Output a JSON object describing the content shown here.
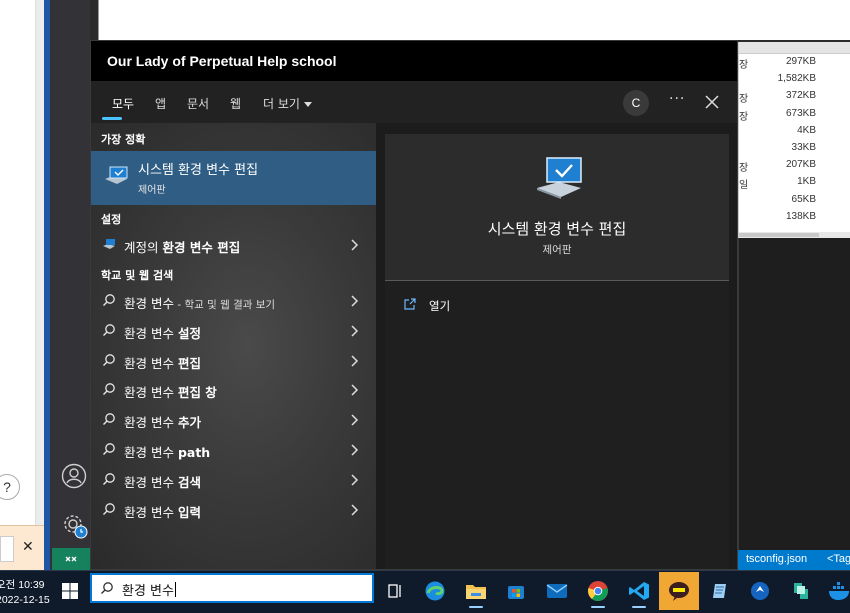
{
  "window": {
    "title": "Our Lady of Perpetual Help school"
  },
  "tabs": [
    {
      "label": "모두",
      "active": true
    },
    {
      "label": "앱"
    },
    {
      "label": "문서"
    },
    {
      "label": "웹"
    },
    {
      "label": "더 보기"
    }
  ],
  "account_initial": "C",
  "sections": {
    "best_match": "가장 정확",
    "settings": "설정",
    "web_search": "학교 및 웹 검색"
  },
  "best_match": {
    "title": "시스템 환경 변수 편집",
    "subtitle": "제어판"
  },
  "settings_item": {
    "pre": "계정의 ",
    "bold": "환경 변수 편집"
  },
  "web_results": [
    {
      "prefix": "환경 변수",
      "bold": "",
      "small": " - 학교 및 웹 결과 보기"
    },
    {
      "prefix": "환경 변수 ",
      "bold": "설정",
      "small": ""
    },
    {
      "prefix": "환경 변수 ",
      "bold": "편집",
      "small": ""
    },
    {
      "prefix": "환경 변수 ",
      "bold": "편집 창",
      "small": ""
    },
    {
      "prefix": "환경 변수 ",
      "bold": "추가",
      "small": ""
    },
    {
      "prefix": "환경 변수 ",
      "bold": "path",
      "small": ""
    },
    {
      "prefix": "환경 변수 ",
      "bold": "검색",
      "small": ""
    },
    {
      "prefix": "환경 변수 ",
      "bold": "입력",
      "small": ""
    }
  ],
  "preview": {
    "title": "시스템 환경 변수 편집",
    "subtitle": "제어판",
    "open_label": "열기"
  },
  "search": {
    "query": "환경 변수"
  },
  "background": {
    "file_rows": [
      {
        "k": "장",
        "size": "297KB"
      },
      {
        "k": "",
        "size": "1,582KB"
      },
      {
        "k": "장",
        "size": "372KB"
      },
      {
        "k": "장",
        "size": "673KB"
      },
      {
        "k": "",
        "size": "4KB"
      },
      {
        "k": "",
        "size": "33KB"
      },
      {
        "k": "장",
        "size": "207KB"
      },
      {
        "k": "일",
        "size": "1KB"
      },
      {
        "k": "",
        "size": "65KB"
      },
      {
        "k": "",
        "size": "138KB"
      }
    ],
    "editor_tabs": [
      "tsconfig.json",
      "<Tag"
    ],
    "help_mark": "?",
    "notif_close": "✕"
  },
  "clock": {
    "time": "오전 10:39",
    "date": "2022-12-15"
  },
  "colors": {
    "accent": "#4cc2ff",
    "best_match_bg": "#2f5d84",
    "taskbar": "#0f1b2a",
    "searchbox_border": "#0078d4"
  }
}
